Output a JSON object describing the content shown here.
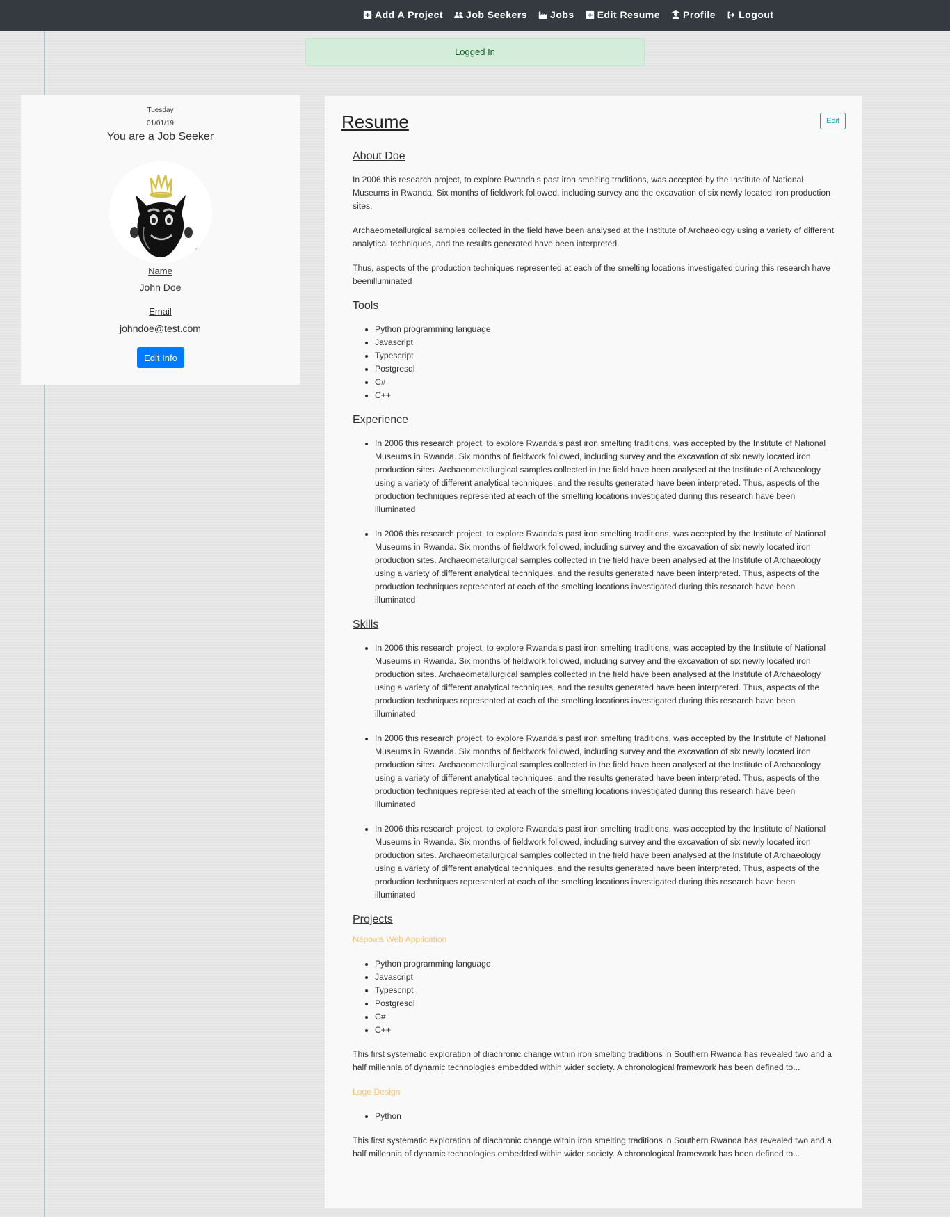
{
  "nav": {
    "items": [
      {
        "label": "Add A Project",
        "icon": "plus-square-icon"
      },
      {
        "label": "Job Seekers",
        "icon": "users-icon"
      },
      {
        "label": "Jobs",
        "icon": "industry-icon"
      },
      {
        "label": "Edit Resume",
        "icon": "plus-square-icon"
      },
      {
        "label": "Profile",
        "icon": "user-graduate-icon"
      },
      {
        "label": "Logout",
        "icon": "sign-out-icon"
      }
    ]
  },
  "alert": {
    "text": "Logged In"
  },
  "profile": {
    "day": "Tuesday",
    "date": "01/01/19",
    "role": "You are a Job Seeker",
    "name_label": "Name",
    "name": "John Doe",
    "email_label": "Email",
    "email": "johndoe@test.com",
    "edit_button": "Edit Info"
  },
  "resume": {
    "title": "Resume",
    "edit_button": "Edit",
    "about": {
      "heading": "About Doe",
      "paragraphs": [
        "In 2006 this research project, to explore Rwanda’s past iron smelting traditions, was accepted by the Institute of National Museums in Rwanda. Six months of fieldwork followed, including survey and the excavation of six newly located iron production sites.",
        "Archaeometallurgical samples collected in the field have been analysed at the Institute of Archaeology using a variety of different analytical techniques, and the results generated have been interpreted.",
        "Thus, aspects of the production techniques represented at each of the smelting locations investigated during this research have beenilluminated"
      ]
    },
    "tools": {
      "heading": "Tools",
      "items": [
        "Python programming language",
        "Javascript",
        "Typescript",
        "Postgresql",
        "C#",
        "C++"
      ]
    },
    "experience": {
      "heading": "Experience",
      "items": [
        "In 2006 this research project, to explore Rwanda’s past iron smelting traditions, was accepted by the Institute of National Museums in Rwanda. Six months of fieldwork followed, including survey and the excavation of six newly located iron production sites. Archaeometallurgical samples collected in the field have been analysed at the Institute of Archaeology using a variety of different analytical techniques, and the results generated have been interpreted. Thus, aspects of the production techniques represented at each of the smelting locations investigated during this research have been illuminated",
        "In 2006 this research project, to explore Rwanda’s past iron smelting traditions, was accepted by the Institute of National Museums in Rwanda. Six months of fieldwork followed, including survey and the excavation of six newly located iron production sites. Archaeometallurgical samples collected in the field have been analysed at the Institute of Archaeology using a variety of different analytical techniques, and the results generated have been interpreted. Thus, aspects of the production techniques represented at each of the smelting locations investigated during this research have been illuminated"
      ]
    },
    "skills": {
      "heading": "Skills",
      "items": [
        "In 2006 this research project, to explore Rwanda’s past iron smelting traditions, was accepted by the Institute of National Museums in Rwanda. Six months of fieldwork followed, including survey and the excavation of six newly located iron production sites. Archaeometallurgical samples collected in the field have been analysed at the Institute of Archaeology using a variety of different analytical techniques, and the results generated have been interpreted. Thus, aspects of the production techniques represented at each of the smelting locations investigated during this research have been illuminated",
        "In 2006 this research project, to explore Rwanda’s past iron smelting traditions, was accepted by the Institute of National Museums in Rwanda. Six months of fieldwork followed, including survey and the excavation of six newly located iron production sites. Archaeometallurgical samples collected in the field have been analysed at the Institute of Archaeology using a variety of different analytical techniques, and the results generated have been interpreted. Thus, aspects of the production techniques represented at each of the smelting locations investigated during this research have been illuminated",
        "In 2006 this research project, to explore Rwanda’s past iron smelting traditions, was accepted by the Institute of National Museums in Rwanda. Six months of fieldwork followed, including survey and the excavation of six newly located iron production sites. Archaeometallurgical samples collected in the field have been analysed at the Institute of Archaeology using a variety of different analytical techniques, and the results generated have been interpreted. Thus, aspects of the production techniques represented at each of the smelting locations investigated during this research have been illuminated"
      ]
    },
    "projects": {
      "heading": "Projects",
      "list": [
        {
          "title": "Napowa Web Application",
          "tools": [
            "Python programming language",
            "Javascript",
            "Typescript",
            "Postgresql",
            "C#",
            "C++"
          ],
          "description": "This first systematic exploration of diachronic change within iron smelting traditions in Southern Rwanda has revealed two and a half millennia of dynamic technologies embedded within wider society. A chronological framework has been defined to..."
        },
        {
          "title": "Logo Design",
          "tools": [
            "Python"
          ],
          "description": "This first systematic exploration of diachronic change within iron smelting traditions in Southern Rwanda has revealed two and a half millennia of dynamic technologies embedded within wider society. A chronological framework has been defined to..."
        }
      ]
    }
  },
  "colors": {
    "navbar": "#343a40",
    "primary": "#007bff",
    "info": "#17a2b8",
    "project_link": "#f7c67b",
    "alert_bg": "#d4edda"
  }
}
